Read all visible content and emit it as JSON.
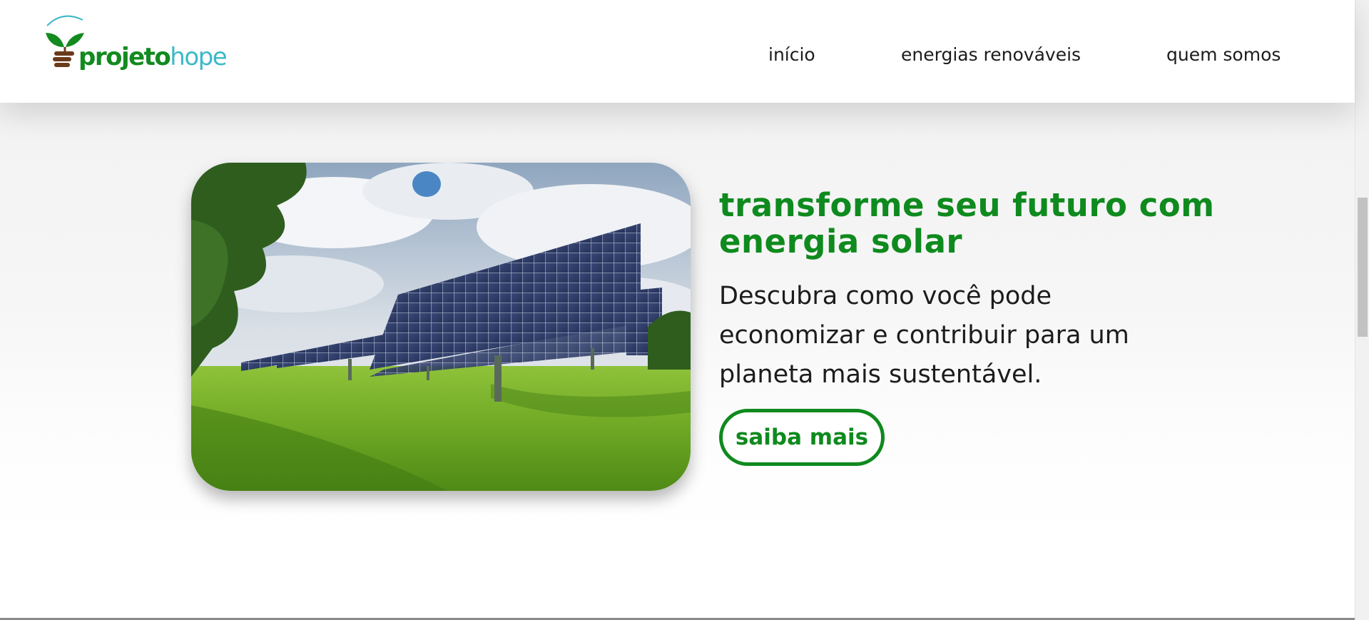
{
  "header": {
    "logo": {
      "text_bold": "projeto",
      "text_light": "hope",
      "colors": {
        "green": "#128a1f",
        "teal": "#3cb8c8",
        "brown": "#6b3a1c"
      }
    },
    "nav": [
      {
        "label": "início"
      },
      {
        "label": "energias renováveis"
      },
      {
        "label": "quem somos"
      }
    ]
  },
  "hero": {
    "image": {
      "icon": "solar-panels-photo"
    },
    "headline": "transforme seu futuro com energia solar",
    "description": "Descubra como você pode economizar e contribuir para um planeta mais sustentável.",
    "cta_label": "saiba mais",
    "accent_color": "#0f8a1e"
  }
}
